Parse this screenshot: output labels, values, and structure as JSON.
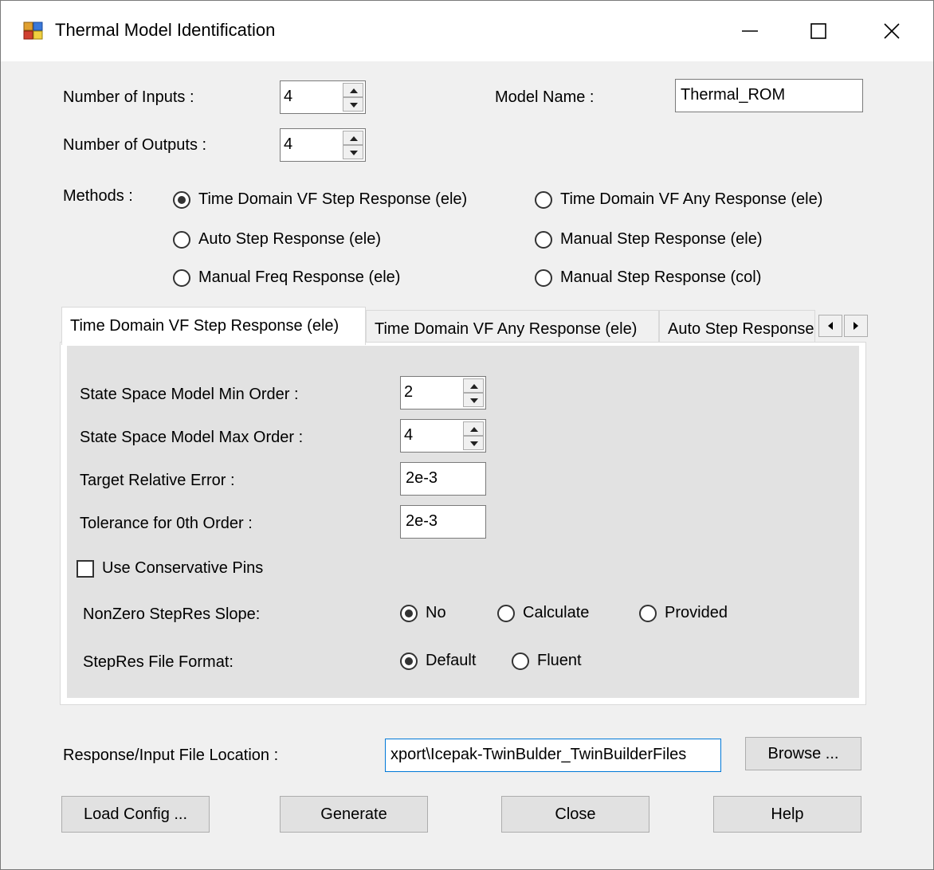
{
  "window": {
    "title": "Thermal Model Identification",
    "icons": {
      "app": "app-window-icon",
      "minimize": "minimize-icon",
      "maximize": "maximize-icon",
      "close": "close-icon"
    }
  },
  "inputs": {
    "num_inputs_label": "Number of Inputs :",
    "num_inputs_value": "4",
    "num_outputs_label": "Number of Outputs :",
    "num_outputs_value": "4",
    "model_name_label": "Model Name :",
    "model_name_value": "Thermal_ROM"
  },
  "methods": {
    "label": "Methods :",
    "options": [
      {
        "label": "Time Domain VF Step Response (ele)",
        "selected": true
      },
      {
        "label": "Time Domain VF Any Response (ele)",
        "selected": false
      },
      {
        "label": "Auto Step Response (ele)",
        "selected": false
      },
      {
        "label": "Manual Step Response (ele)",
        "selected": false
      },
      {
        "label": "Manual Freq Response (ele)",
        "selected": false
      },
      {
        "label": "Manual Step Response (col)",
        "selected": false
      }
    ]
  },
  "tabs": [
    {
      "label": "Time Domain VF Step Response (ele)",
      "active": true
    },
    {
      "label": "Time Domain VF Any Response (ele)",
      "active": false
    },
    {
      "label": "Auto Step Response (ele)",
      "active": false
    }
  ],
  "panel": {
    "min_order_label": "State Space Model Min Order :",
    "min_order_value": "2",
    "max_order_label": "State Space Model Max Order :",
    "max_order_value": "4",
    "target_error_label": "Target Relative Error :",
    "target_error_value": "2e-3",
    "tolerance_label": "Tolerance for 0th Order  :",
    "tolerance_value": "2e-3",
    "conservative_pins_label": "Use Conservative Pins",
    "conservative_pins_checked": false,
    "slope_label": "NonZero StepRes Slope:",
    "slope_options": [
      {
        "label": "No",
        "selected": true
      },
      {
        "label": "Calculate",
        "selected": false
      },
      {
        "label": "Provided",
        "selected": false
      }
    ],
    "format_label": "StepRes File Format:",
    "format_options": [
      {
        "label": "Default",
        "selected": true
      },
      {
        "label": "Fluent",
        "selected": false
      }
    ]
  },
  "file": {
    "label": "Response/Input File Location :",
    "value": "xport\\Icepak-TwinBulder_TwinBuilderFiles",
    "browse_label": "Browse ..."
  },
  "buttons": {
    "load_config": "Load Config ...",
    "generate": "Generate",
    "close": "Close",
    "help": "Help"
  }
}
